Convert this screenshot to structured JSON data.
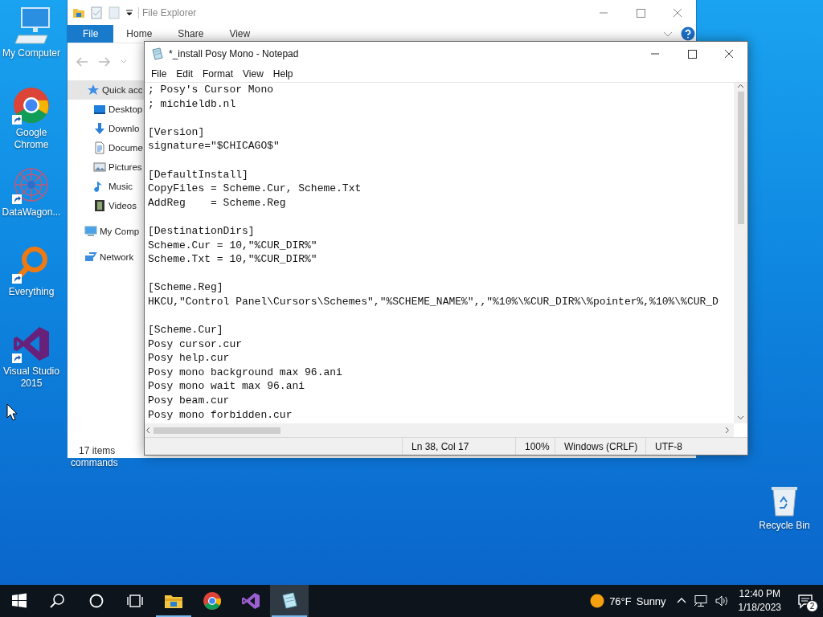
{
  "desktop_icons": [
    {
      "label": "My Computer",
      "kind": "computer",
      "shortcut": false
    },
    {
      "label": "Google Chrome",
      "kind": "chrome",
      "shortcut": true
    },
    {
      "label": "DataWagon...",
      "kind": "datawagon",
      "shortcut": true
    },
    {
      "label": "Everything",
      "kind": "everything",
      "shortcut": true
    },
    {
      "label": "Visual Studio 2015",
      "kind": "vs",
      "shortcut": true
    }
  ],
  "desktop_label_fragment": "commands",
  "recycle_bin": {
    "label": "Recycle Bin"
  },
  "explorer": {
    "title": "File Explorer",
    "ribbon_tabs": [
      {
        "label": "File",
        "selected": true
      },
      {
        "label": "Home",
        "selected": false
      },
      {
        "label": "Share",
        "selected": false
      },
      {
        "label": "View",
        "selected": false
      }
    ],
    "sidebar": [
      {
        "label": "Quick acc",
        "kind": "star",
        "selected": true,
        "children": [
          {
            "label": "Desktop",
            "kind": "desktop",
            "selected": false
          },
          {
            "label": "Downlo",
            "kind": "download",
            "selected": false
          },
          {
            "label": "Docume",
            "kind": "document",
            "selected": false
          },
          {
            "label": "Pictures",
            "kind": "picture",
            "selected": false
          },
          {
            "label": "Music",
            "kind": "music",
            "selected": false
          },
          {
            "label": "Videos",
            "kind": "video",
            "selected": false
          }
        ]
      },
      {
        "label": "My Comp",
        "kind": "computer",
        "selected": false
      },
      {
        "label": "Network",
        "kind": "network",
        "selected": false
      }
    ],
    "status": "17 items"
  },
  "notepad": {
    "title": "*_install Posy Mono - Notepad",
    "menu": [
      "File",
      "Edit",
      "Format",
      "View",
      "Help"
    ],
    "blocks": [
      [
        "; Posy's Cursor Mono",
        "; michieldb.nl"
      ],
      [
        "[Version]",
        "signature=\"$CHICAGO$\""
      ],
      [
        "[DefaultInstall]",
        "CopyFiles = Scheme.Cur, Scheme.Txt",
        "AddReg    = Scheme.Reg"
      ],
      [
        "[DestinationDirs]",
        "Scheme.Cur = 10,\"%CUR_DIR%\"",
        "Scheme.Txt = 10,\"%CUR_DIR%\""
      ],
      [
        "[Scheme.Reg]",
        "HKCU,\"Control Panel\\Cursors\\Schemes\",\"%SCHEME_NAME%\",,\"%10%\\%CUR_DIR%\\%pointer%,%10%\\%CUR_D"
      ],
      [
        "[Scheme.Cur]",
        "Posy cursor.cur",
        "Posy help.cur",
        "Posy mono background max 96.ani",
        "Posy mono wait max 96.ani",
        "Posy beam.cur",
        "Posy mono forbidden.cur"
      ]
    ],
    "status": [
      "Ln 38, Col 17",
      "100%",
      "Windows (CRLF)",
      "UTF-8"
    ]
  },
  "taskbar": {
    "apps": [
      {
        "kind": "explorer",
        "running": true,
        "selected": false
      },
      {
        "kind": "chrome",
        "running": false,
        "selected": false
      },
      {
        "kind": "vs",
        "running": false,
        "selected": false
      },
      {
        "kind": "notepad",
        "running": true,
        "selected": true
      }
    ],
    "weather": {
      "temperature": "76°F",
      "condition": "Sunny"
    },
    "time": "12:40 PM",
    "date": "1/18/2023",
    "notifications": "2"
  }
}
